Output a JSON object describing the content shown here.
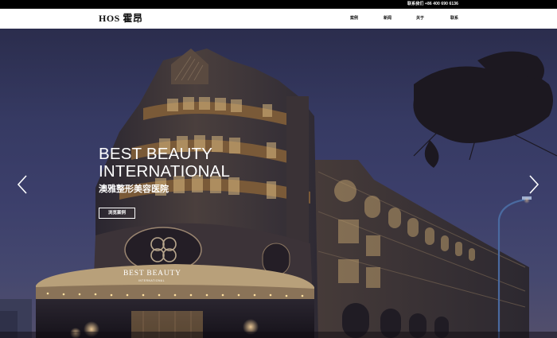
{
  "topbar": {
    "contact": "联系我们 +86 400 690 6136"
  },
  "header": {
    "logo": "HOS 霍昂",
    "nav": [
      {
        "label": "案例"
      },
      {
        "label": "新闻"
      },
      {
        "label": "关于"
      },
      {
        "label": "联系"
      }
    ]
  },
  "hero": {
    "title": "BEST BEAUTY\nINTERNATIONAL",
    "subtitle": "澳雅整形美容医院",
    "button_label": "浏览案例",
    "sign_text": "BEST BEAUTY",
    "sign_subtext": "INTERNATIONAL",
    "prev_icon": "chevron-left-icon",
    "next_icon": "chevron-right-icon"
  }
}
